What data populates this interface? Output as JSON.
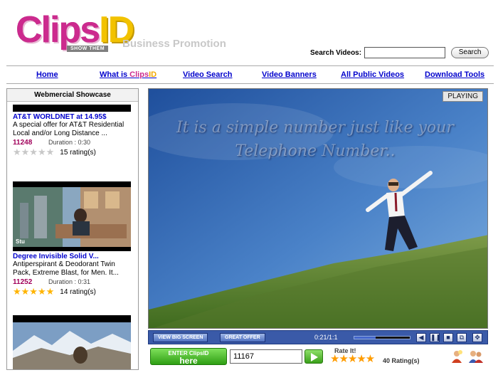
{
  "brand": {
    "logo_clips": "Clips",
    "logo_id": "ID",
    "logo_sub": "SHOW THEM",
    "tagline": "Business Promotion"
  },
  "search": {
    "label": "Search Videos:",
    "value": "",
    "button": "Search"
  },
  "nav": {
    "home": "Home",
    "what_is_prefix": "What is ",
    "what_is_clips": "Clips",
    "what_is_id": "ID",
    "video_search": "Video Search",
    "video_banners": "Video Banners",
    "all_public_videos": "All Public Videos",
    "download_tools": "Download Tools"
  },
  "sidebar": {
    "heading": "Webmercial Showcase",
    "items": [
      {
        "title": "AT&T WORLDNET at 14.95$",
        "desc": "A special offer for AT&T Residential Local and/or Long Distance ...",
        "id": "11248",
        "duration": "Duration : 0:30",
        "rating": 0,
        "rating_text": "15 rating(s)"
      },
      {
        "title": "Degree Invisible Solid V...",
        "desc": "Antiperspirant & Deodorant Twin Pack, Extreme Blast, for Men. It...",
        "id": "11252",
        "duration": "Duration : 0:31",
        "rating": 5,
        "rating_text": "14 rating(s)",
        "thumb_caption": "Stu"
      },
      {
        "title": "",
        "desc": ""
      }
    ]
  },
  "player": {
    "status": "PLAYING",
    "caption_line1": "It is a simple number just like your",
    "caption_line2": "Telephone Number..",
    "view_big_screen": "VIEW BIG SCREEN",
    "great_offer": "GREAT OFFER",
    "time": "0:21/1:1",
    "progress": 0.38
  },
  "enter": {
    "line1": "ENTER ClipsID",
    "line2": "here",
    "value": "11167"
  },
  "rating": {
    "label": "Rate It!",
    "stars": 5,
    "count_text": "40 Rating(s)"
  },
  "colors": {
    "brand_pink": "#cc2a8e",
    "brand_yellow": "#f2c200",
    "link_blue": "#0000cc",
    "id_red": "#a0005a",
    "control_blue": "#3a5aa8",
    "enter_green": "#2f9e14"
  }
}
